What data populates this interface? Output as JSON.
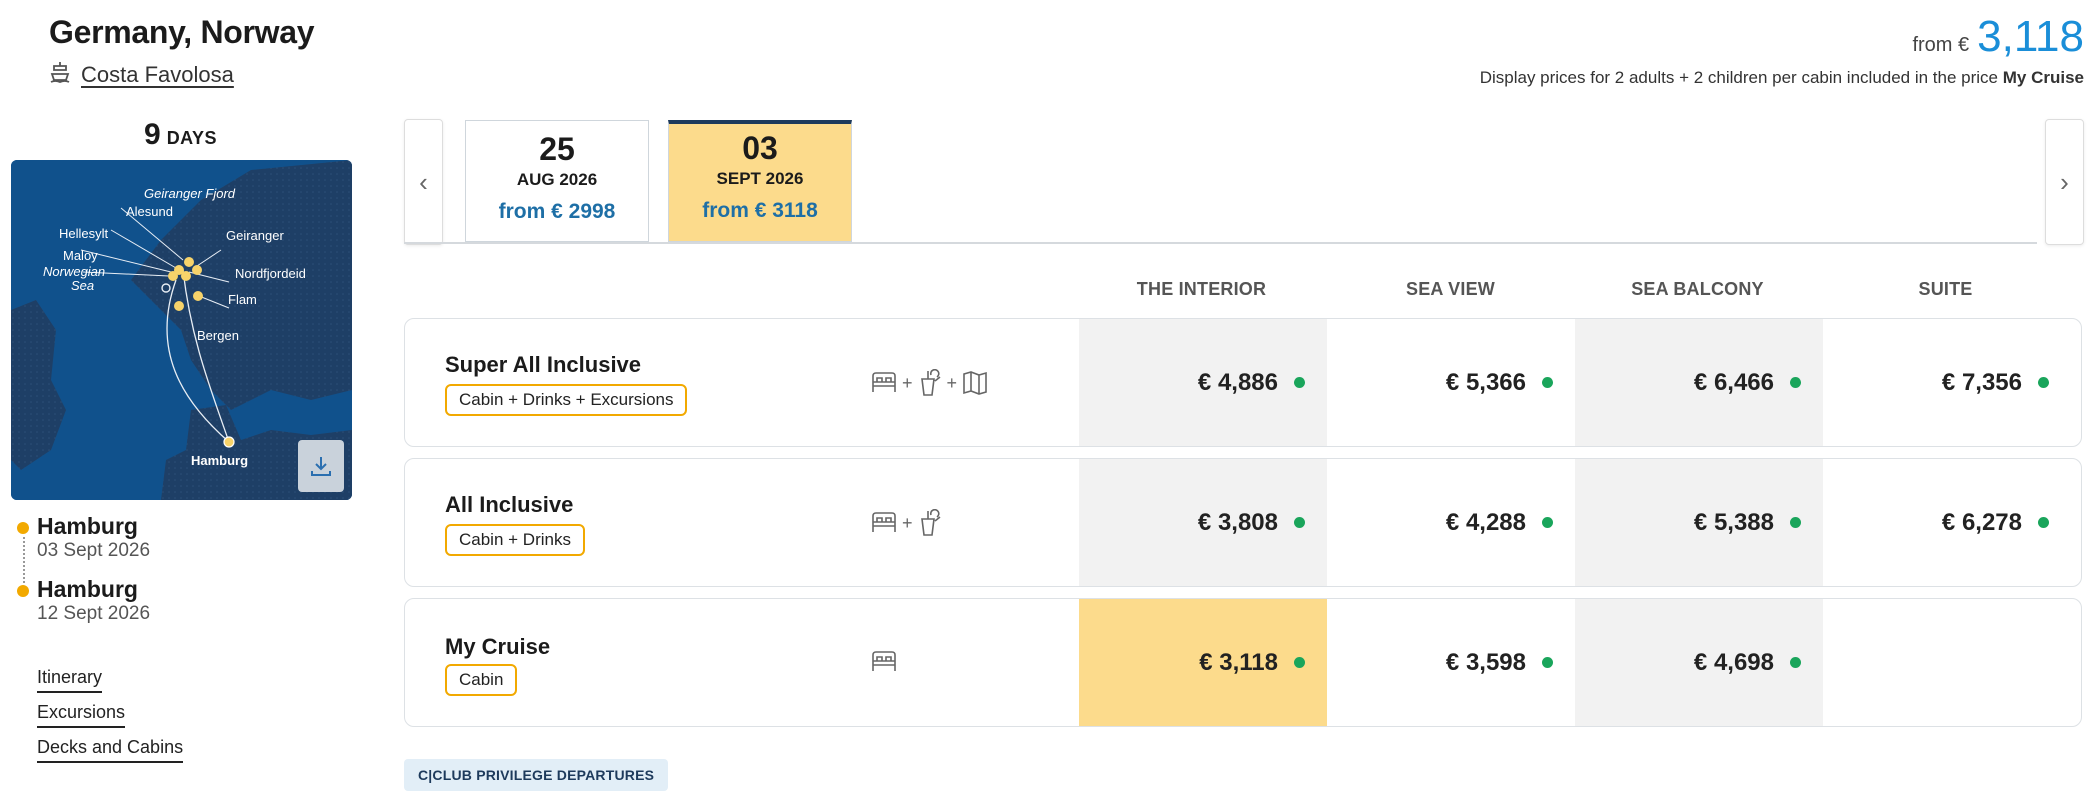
{
  "header": {
    "route": "Germany, Norway",
    "ship_name": "Costa Favolosa",
    "from_label": "from €",
    "from_value": "3,118",
    "price_note": "Display prices for 2 adults + 2 children per cabin included in the price",
    "price_note_bold": "My Cruise"
  },
  "trip": {
    "days_number": "9",
    "days_label": "DAYS"
  },
  "map": {
    "labels": {
      "fjord": "Geiranger Fjord",
      "alesund": "Alesund",
      "hellesylt": "Hellesylt",
      "geiranger": "Geiranger",
      "maloy": "Maloy",
      "norwegian": "Norwegian",
      "sea": "Sea",
      "nordfjordeid": "Nordfjordeid",
      "flam": "Flam",
      "bergen": "Bergen",
      "hamburg": "Hamburg"
    }
  },
  "ports": [
    {
      "name": "Hamburg",
      "date": "03 Sept 2026"
    },
    {
      "name": "Hamburg",
      "date": "12 Sept 2026"
    }
  ],
  "left_links": [
    "Itinerary",
    "Excursions",
    "Decks and Cabins"
  ],
  "dates": [
    {
      "day": "25",
      "month": "AUG 2026",
      "from": "from € 2998"
    },
    {
      "day": "03",
      "month": "SEPT 2026",
      "from": "from € 3118"
    }
  ],
  "columns": [
    "THE INTERIOR",
    "SEA VIEW",
    "SEA BALCONY",
    "SUITE"
  ],
  "packages": [
    {
      "title": "Super All Inclusive",
      "badge": "Cabin + Drinks + Excursions",
      "prices": [
        "€ 4,886",
        "€ 5,366",
        "€ 6,466",
        "€ 7,356"
      ]
    },
    {
      "title": "All Inclusive",
      "badge": "Cabin + Drinks",
      "prices": [
        "€ 3,808",
        "€ 4,288",
        "€ 5,388",
        "€ 6,278"
      ]
    },
    {
      "title": "My Cruise",
      "badge": "Cabin",
      "prices": [
        "€ 3,118",
        "€ 3,598",
        "€ 4,698",
        ""
      ]
    }
  ],
  "icons": {
    "plus": "+"
  },
  "club_badge": "C|CLUB PRIVILEGE DEPARTURES",
  "colors": {
    "accent_blue": "#1a8ed8",
    "highlight_yellow": "#fcdb8c",
    "badge_border": "#f2a900",
    "availability_green": "#1aa55b",
    "map_sea": "#10518c"
  }
}
